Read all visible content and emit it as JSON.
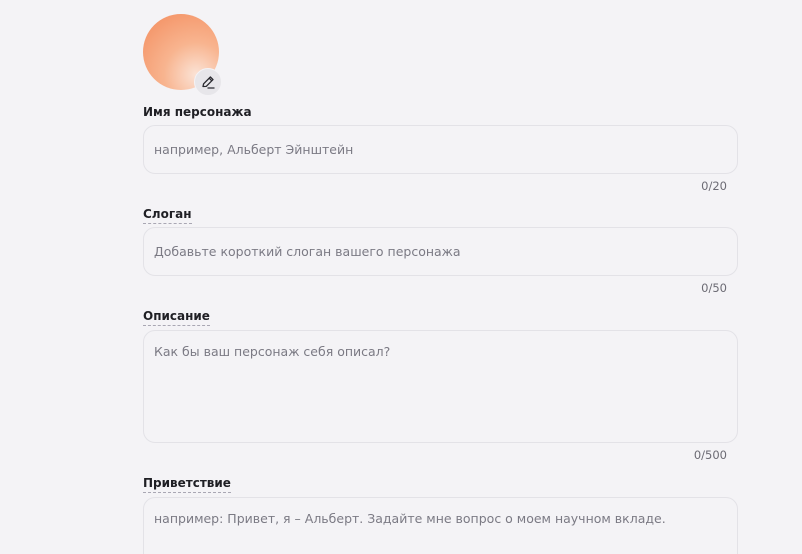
{
  "avatar": {
    "edit_icon": "pencil-icon"
  },
  "fields": {
    "name": {
      "label": "Имя персонажа",
      "placeholder": "например, Альберт Эйнштейн",
      "counter": "0/20"
    },
    "slogan": {
      "label": "Слоган",
      "placeholder": "Добавьте короткий слоган вашего персонажа",
      "counter": "0/50"
    },
    "description": {
      "label": "Описание",
      "placeholder": "Как бы ваш персонаж себя описал?",
      "counter": "0/500"
    },
    "greeting": {
      "label": "Приветствие",
      "placeholder": "например: Привет, я – Альберт. Задайте мне вопрос о моем научном вкладе."
    }
  },
  "colors": {
    "background": "#f4f3f6",
    "avatar_gradient": [
      "#f38b5c",
      "#fbe3d6"
    ]
  }
}
